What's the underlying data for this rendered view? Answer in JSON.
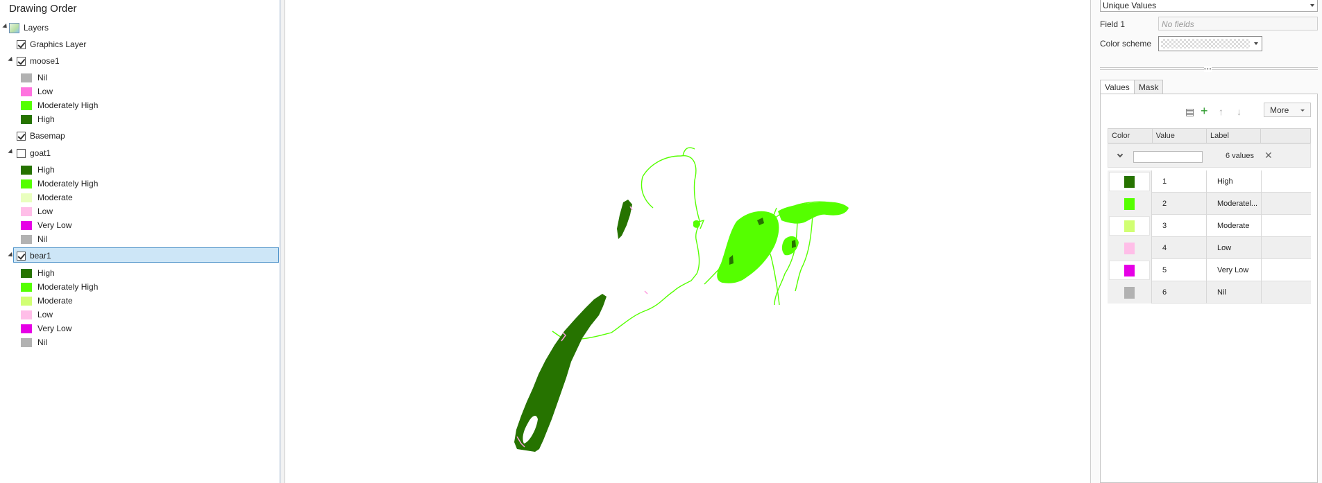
{
  "contents": {
    "title": "Drawing Order",
    "layers_root": "Layers",
    "graphics_layer": "Graphics Layer",
    "moose": {
      "name": "moose1",
      "legend": [
        {
          "label": "Nil",
          "color": "#b2b2b2"
        },
        {
          "label": "Low",
          "color": "#ff73df"
        },
        {
          "label": "Moderately High",
          "color": "#55ff00"
        },
        {
          "label": "High",
          "color": "#267300"
        }
      ]
    },
    "basemap": "Basemap",
    "goat": {
      "name": "goat1",
      "legend": [
        {
          "label": "High",
          "color": "#267300"
        },
        {
          "label": "Moderately High",
          "color": "#55ff00"
        },
        {
          "label": "Moderate",
          "color": "#e9ffbe"
        },
        {
          "label": "Low",
          "color": "#ffbee8"
        },
        {
          "label": "Very Low",
          "color": "#e600e6"
        },
        {
          "label": "Nil",
          "color": "#b2b2b2"
        }
      ]
    },
    "bear": {
      "name": "bear1",
      "legend": [
        {
          "label": "High",
          "color": "#267300"
        },
        {
          "label": "Moderately High",
          "color": "#55ff00"
        },
        {
          "label": "Moderate",
          "color": "#d1ff73"
        },
        {
          "label": "Low",
          "color": "#ffbee8"
        },
        {
          "label": "Very Low",
          "color": "#e600e6"
        },
        {
          "label": "Nil",
          "color": "#b2b2b2"
        }
      ]
    }
  },
  "symbology": {
    "renderer": "Unique Values",
    "field1_label": "Field 1",
    "field1_value": "No fields",
    "color_scheme_label": "Color scheme",
    "tabs": [
      "Values",
      "Mask"
    ],
    "more_label": "More",
    "columns": [
      "Color",
      "Value",
      "Label"
    ],
    "values_count": "6 values",
    "rows": [
      {
        "value": "1",
        "label": "High",
        "color": "#267300"
      },
      {
        "value": "2",
        "label": "Moderatel...",
        "color": "#55ff00"
      },
      {
        "value": "3",
        "label": "Moderate",
        "color": "#d1ff73"
      },
      {
        "value": "4",
        "label": "Low",
        "color": "#ffbee8"
      },
      {
        "value": "5",
        "label": "Very Low",
        "color": "#e600e6"
      },
      {
        "value": "6",
        "label": "Nil",
        "color": "#b2b2b2"
      }
    ]
  }
}
